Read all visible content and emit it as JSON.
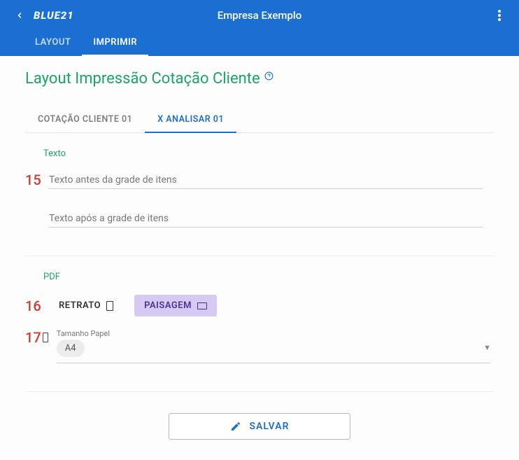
{
  "header": {
    "logo": "BLUE21",
    "title": "Empresa Exemplo",
    "tabs": [
      {
        "label": "LAYOUT"
      },
      {
        "label": "IMPRIMIR"
      }
    ]
  },
  "page": {
    "title": "Layout Impressão Cotação Cliente"
  },
  "subtabs": [
    {
      "label": "COTAÇÃO CLIENTE 01"
    },
    {
      "label": "X ANALISAR 01"
    }
  ],
  "section_texto": {
    "label": "Texto",
    "number": "15",
    "ph_before": "Texto antes da grade de itens",
    "ph_after": "Texto após a grade de itens"
  },
  "section_pdf": {
    "label": "PDF",
    "number_orient": "16",
    "portrait": "RETRATO",
    "landscape": "PAISAGEM",
    "number_paper": "17",
    "paper_label": "Tamanho Papel",
    "paper_value": "A4"
  },
  "actions": {
    "save": "SALVAR"
  }
}
